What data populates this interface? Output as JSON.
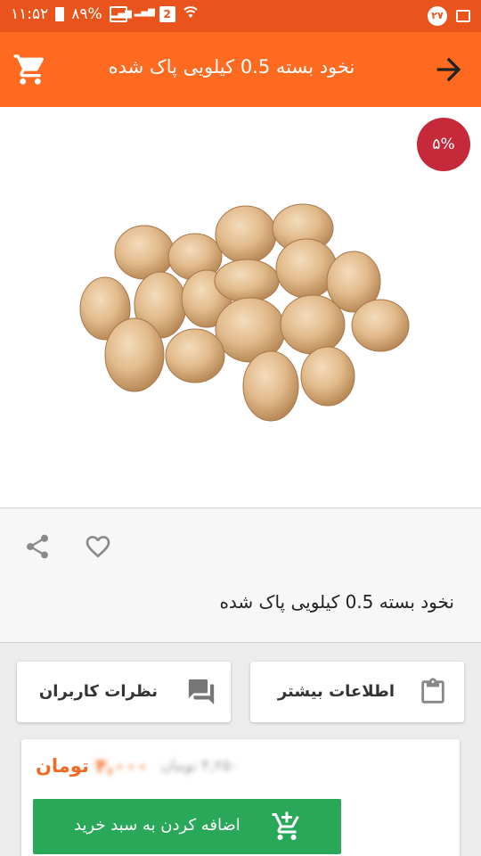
{
  "status_bar": {
    "time": "۱۱:۵۲",
    "battery": "۸۹%",
    "sim_badge": "2",
    "notification_count": "۲۷"
  },
  "app_bar": {
    "title": "نخود بسته 0.5 کیلویی پاک شده",
    "cart_icon": "shopping-cart-icon",
    "back_icon": "arrow-forward-icon"
  },
  "product": {
    "discount_badge": "۵%",
    "name": "نخود بسته 0.5 کیلویی پاک شده",
    "share_icon": "share-icon",
    "favorite_icon": "heart-outline-icon"
  },
  "actions": {
    "more_info_label": "اطلاعات بیشتر",
    "more_info_icon": "clipboard-icon",
    "comments_label": "نظرات کاربران",
    "comments_icon": "chat-icon"
  },
  "purchase": {
    "old_price": "۴,۲۵۰ تومان",
    "current_price_amount": "۴,۰۰۰",
    "currency": "تومان",
    "add_to_cart_label": "اضافه کردن به سبد خرید",
    "add_to_cart_icon": "add-to-cart-icon"
  },
  "colors": {
    "status_bar": "#e8541b",
    "app_bar": "#fd6a20",
    "discount_badge": "#c62a3a",
    "price": "#f26a22",
    "add_to_cart": "#2aa85a"
  }
}
